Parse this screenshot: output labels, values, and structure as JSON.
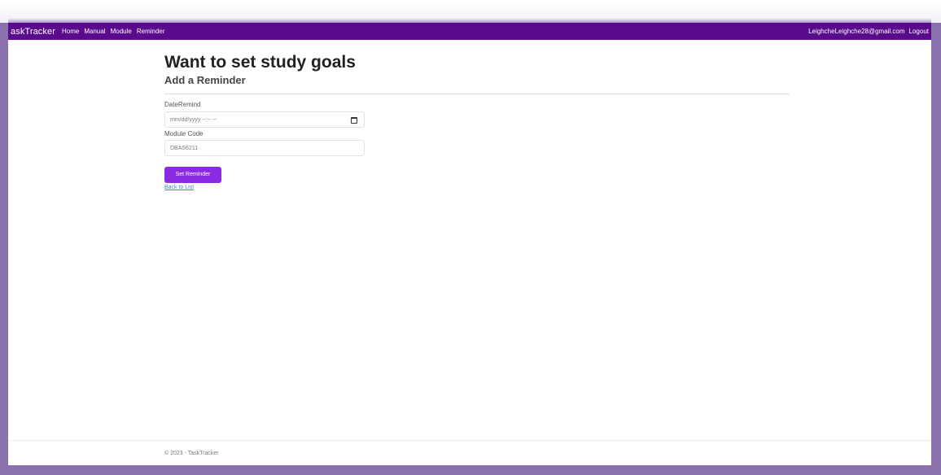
{
  "navbar": {
    "brand": "askTracker",
    "links": [
      "Home",
      "Manual",
      "Module",
      "Reminder"
    ],
    "user_email": "LeighcheLeighche28@gmail.com",
    "logout": "Logout"
  },
  "page": {
    "title": "Want to set study goals",
    "subtitle": "Add a Reminder"
  },
  "form": {
    "date_label": "DateRemind",
    "date_value": "mm/dd/yyyy --:-- --",
    "module_label": "Module Code",
    "module_value": "DBAS6211",
    "submit_label": "Set Reminder",
    "back_link": "Back to List"
  },
  "footer": {
    "text": "© 2023 - TaskTracker"
  },
  "colors": {
    "navbar": "#5a0a8c",
    "button": "#8a2be2",
    "frame": "#8a70ad"
  }
}
